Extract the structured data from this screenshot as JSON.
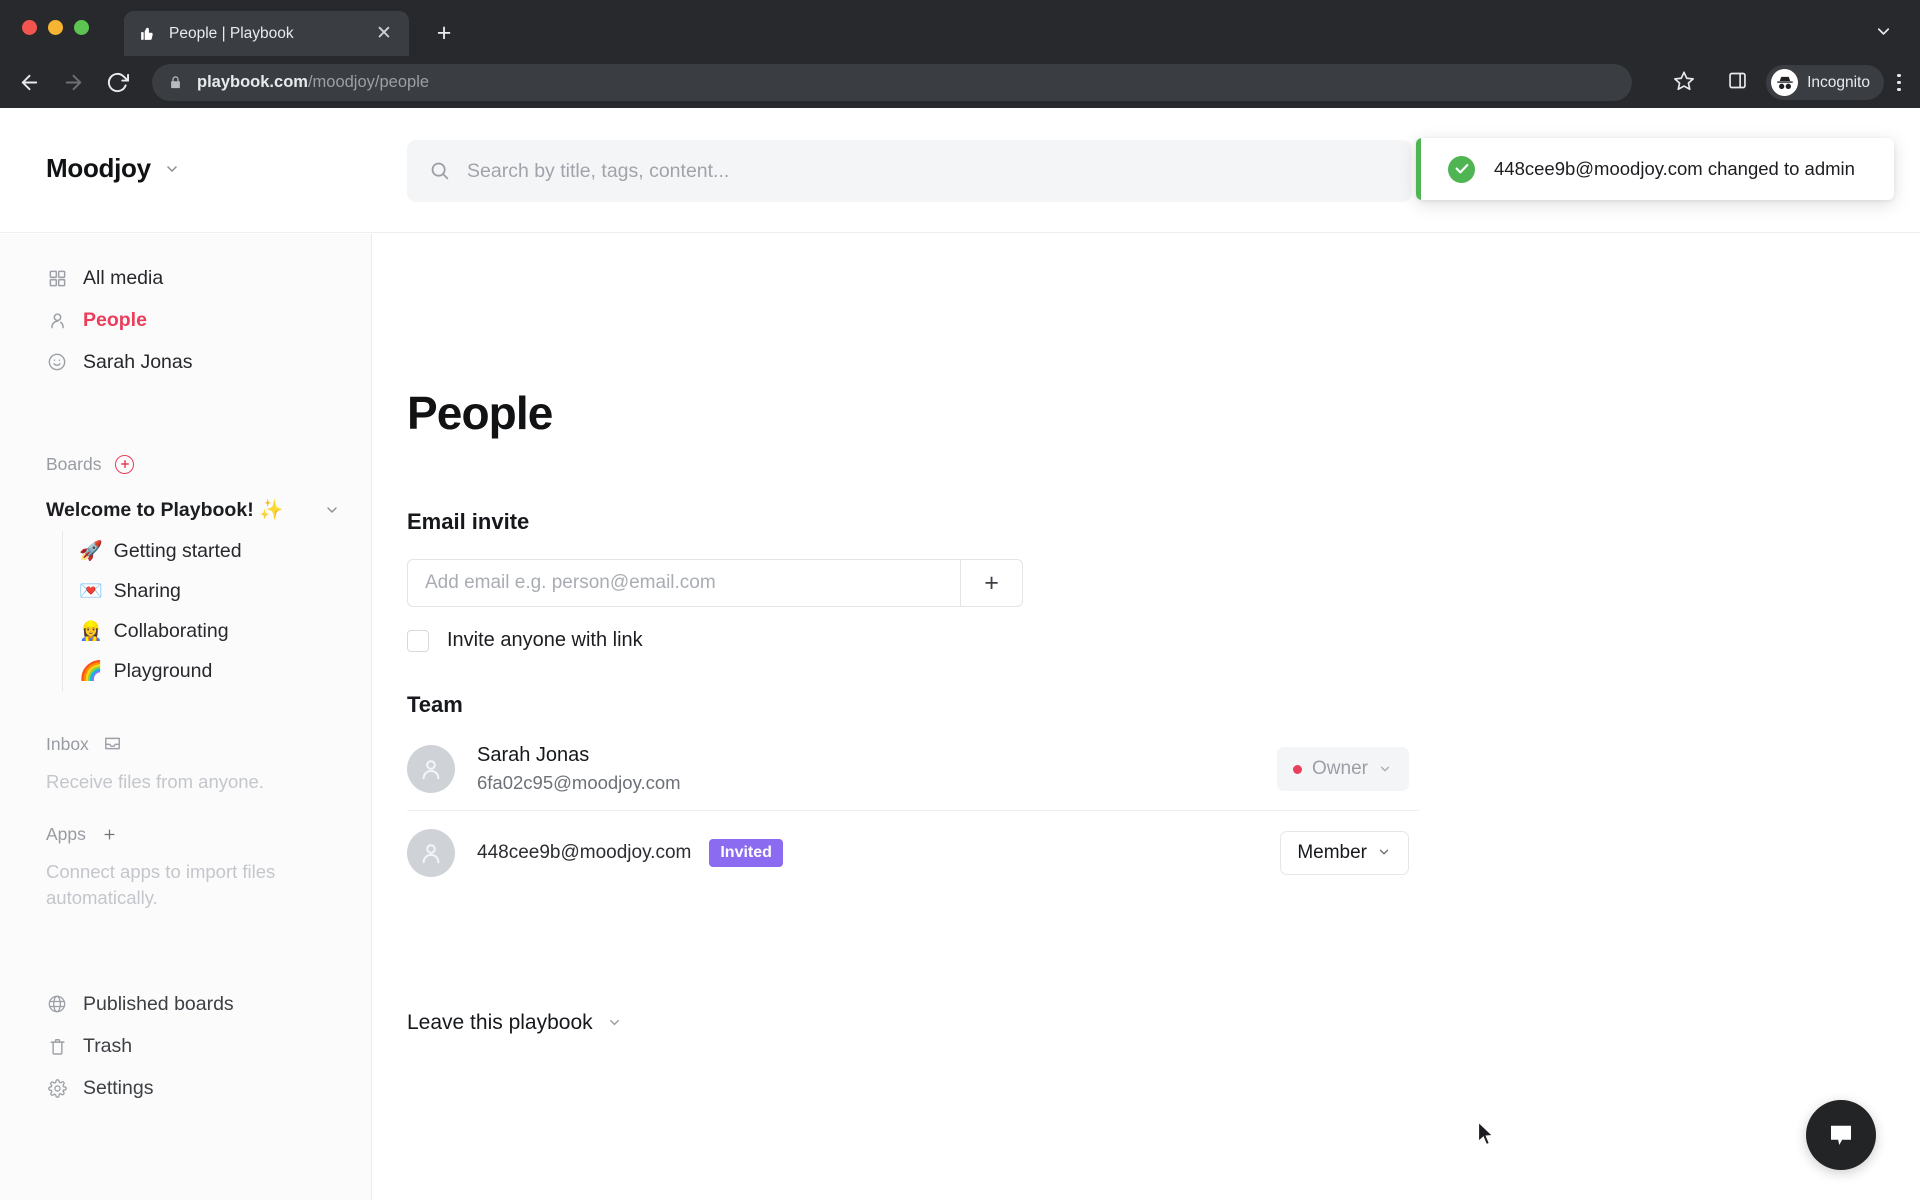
{
  "browser": {
    "tab_title": "People | Playbook",
    "tab_favicon_icon": "playbook-thumb-icon",
    "close_tab_label": "✕",
    "new_tab_label": "+",
    "url_domain": "playbook.com",
    "url_path": "/moodjoy/people",
    "profile_label": "Incognito",
    "back_icon": "back-arrow-icon",
    "forward_icon": "forward-arrow-icon",
    "reload_icon": "reload-icon",
    "lock_icon": "lock-icon",
    "star_icon": "bookmark-star-icon",
    "sidepanel_icon": "side-panel-icon",
    "menu_icon": "kebab-menu-icon",
    "tabstrip_chevron_icon": "chevron-down-icon"
  },
  "topbar": {
    "workspace_name": "Moodjoy",
    "workspace_chevron_icon": "chevron-down-icon"
  },
  "search": {
    "placeholder": "Search by title, tags, content...",
    "icon": "search-icon"
  },
  "toast": {
    "message": "448cee9b@moodjoy.com changed to admin",
    "icon": "success-check-icon",
    "accent_color": "#4fb553"
  },
  "sidebar": {
    "primary_items": [
      {
        "label": "All media",
        "icon": "grid-icon",
        "active": false
      },
      {
        "label": "People",
        "icon": "person-icon",
        "active": true
      },
      {
        "label": "Sarah Jonas",
        "icon": "smiley-icon",
        "active": false
      }
    ],
    "boards": {
      "section_label": "Boards",
      "add_icon": "plus-circle-icon",
      "group_title": "Welcome to Playbook! ✨",
      "collapse_icon": "chevron-down-icon",
      "children": [
        {
          "emoji": "🚀",
          "label": "Getting started"
        },
        {
          "emoji": "💌",
          "label": "Sharing"
        },
        {
          "emoji": "👷‍♀️",
          "label": "Collaborating"
        },
        {
          "emoji": "🌈",
          "label": "Playground"
        }
      ]
    },
    "inbox": {
      "label": "Inbox",
      "icon": "inbox-tray-icon",
      "description": "Receive files from anyone."
    },
    "apps": {
      "label": "Apps",
      "add_icon": "plus-icon",
      "description": "Connect apps to import files automatically."
    },
    "bottom_items": [
      {
        "label": "Published boards",
        "icon": "globe-icon"
      },
      {
        "label": "Trash",
        "icon": "trash-icon"
      },
      {
        "label": "Settings",
        "icon": "gear-icon"
      }
    ],
    "active_color": "#ea3f5c"
  },
  "main": {
    "page_title": "People",
    "email_invite": {
      "heading": "Email invite",
      "input_value": "",
      "input_placeholder": "Add email e.g. person@email.com",
      "add_button_label": "+",
      "checkbox_label": "Invite anyone with link",
      "checkbox_checked": false
    },
    "team": {
      "heading": "Team",
      "members": [
        {
          "name": "Sarah Jonas",
          "email": "6fa02c95@moodjoy.com",
          "badge": "",
          "role": "Owner",
          "role_disabled": true,
          "avatar_icon": "person-avatar-icon",
          "role_dot_color": "#ea3f5c"
        },
        {
          "name": "",
          "email": "448cee9b@moodjoy.com",
          "badge": "Invited",
          "role": "Member",
          "role_disabled": false,
          "avatar_icon": "person-avatar-icon",
          "badge_color": "#8b6cf0"
        }
      ]
    },
    "leave_playbook": {
      "label": "Leave this playbook",
      "chevron_icon": "chevron-down-icon"
    }
  },
  "chat_widget": {
    "icon": "chat-bubble-icon"
  }
}
